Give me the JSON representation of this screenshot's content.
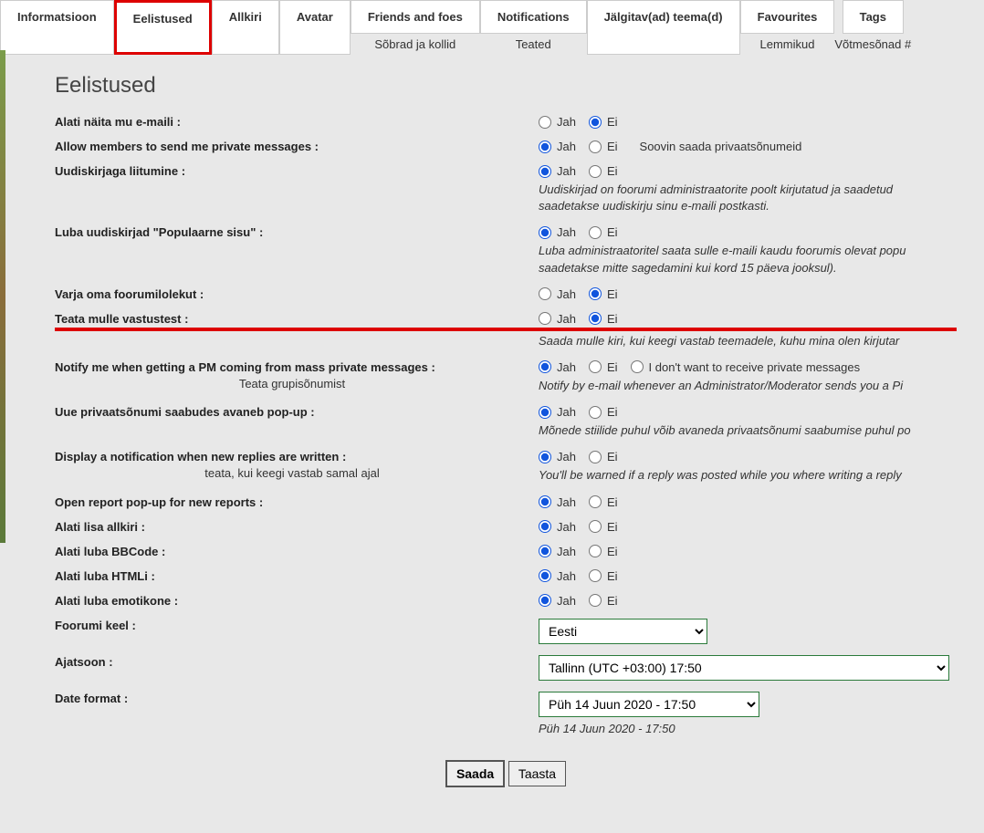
{
  "tabs": [
    {
      "label": "Informatsioon",
      "sub": ""
    },
    {
      "label": "Eelistused",
      "sub": "",
      "active": true
    },
    {
      "label": "Allkiri",
      "sub": ""
    },
    {
      "label": "Avatar",
      "sub": ""
    },
    {
      "label": "Friends and foes",
      "sub": "Sõbrad ja kollid"
    },
    {
      "label": "Notifications",
      "sub": "Teated"
    },
    {
      "label": "Jälgitav(ad) teema(d)",
      "sub": ""
    },
    {
      "label": "Favourites",
      "sub": "Lemmikud"
    },
    {
      "label": "Tags",
      "sub": "Võtmesõnad #"
    }
  ],
  "heading": "Eelistused",
  "yes": "Jah",
  "no": "Ei",
  "rows": {
    "email": {
      "label": "Alati näita mu e-maili :",
      "val": "no"
    },
    "pm": {
      "label": "Allow members to send me private messages :",
      "val": "yes",
      "extra": "Soovin saada privaatsõnumeid"
    },
    "newsletter": {
      "label": "Uudiskirjaga liitumine :",
      "val": "yes",
      "desc": "Uudiskirjad on foorumi administraatorite poolt kirjutatud ja saadetud saadetakse uudiskirju sinu e-maili postkasti."
    },
    "popular": {
      "label": "Luba uudiskirjad \"Populaarne sisu\" :",
      "val": "yes",
      "desc": "Luba administraatoritel saata sulle e-maili kaudu foorumis olevat popu saadetakse mitte sagedamini kui kord 15 päeva jooksul)."
    },
    "hide": {
      "label": "Varja oma foorumilolekut :",
      "val": "no"
    },
    "replies": {
      "label": "Teata mulle vastustest :",
      "val": "no",
      "desc": "Saada mulle kiri, kui keegi vastab teemadele, kuhu mina olen kirjutar",
      "highlight": true
    },
    "masspm": {
      "label": "Notify me when getting a PM coming from mass private messages :",
      "sub": "Teata grupisõnumist",
      "val": "yes",
      "opt3": "I don't want to receive private messages",
      "desc": "Notify by e-mail whenever an Administrator/Moderator sends you a Pi"
    },
    "popup": {
      "label": "Uue privaatsõnumi saabudes avaneb pop-up :",
      "val": "yes",
      "desc": "Mõnede stiilide puhul võib avaneda privaatsõnumi saabumise puhul po"
    },
    "newreply": {
      "label": "Display a notification when new replies are written :",
      "sub": "teata, kui keegi vastab samal ajal",
      "val": "yes",
      "desc": "You'll be warned if a reply was posted while you where writing a reply"
    },
    "report": {
      "label": "Open report pop-up for new reports :",
      "val": "yes"
    },
    "sig": {
      "label": "Alati lisa allkiri :",
      "val": "yes"
    },
    "bbcode": {
      "label": "Alati luba BBCode :",
      "val": "yes"
    },
    "html": {
      "label": "Alati luba HTMLi :",
      "val": "yes"
    },
    "emot": {
      "label": "Alati luba emotikone :",
      "val": "yes"
    },
    "lang": {
      "label": "Foorumi keel :",
      "value": "Eesti"
    },
    "tz": {
      "label": "Ajatsoon :",
      "value": "Tallinn (UTC +03:00) 17:50"
    },
    "date": {
      "label": "Date format :",
      "value": "Püh 14 Juun 2020 - 17:50",
      "desc": "Püh 14 Juun 2020 - 17:50"
    }
  },
  "buttons": {
    "save": "Saada",
    "reset": "Taasta"
  }
}
